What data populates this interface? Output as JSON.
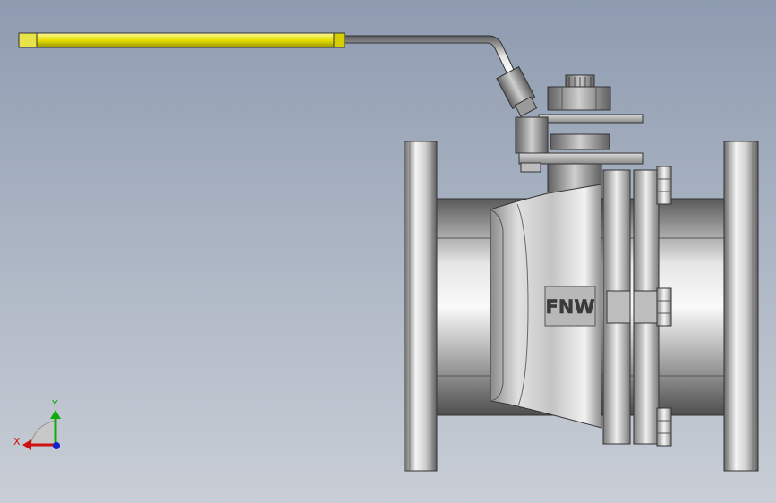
{
  "model": {
    "brand_mark": "FNW",
    "handle_grip_color": "#e8e000"
  },
  "triad": {
    "x_label": "X",
    "y_label": "Y",
    "x_color": "#cc1111",
    "y_color": "#11aa11",
    "z_color": "#1122cc"
  }
}
